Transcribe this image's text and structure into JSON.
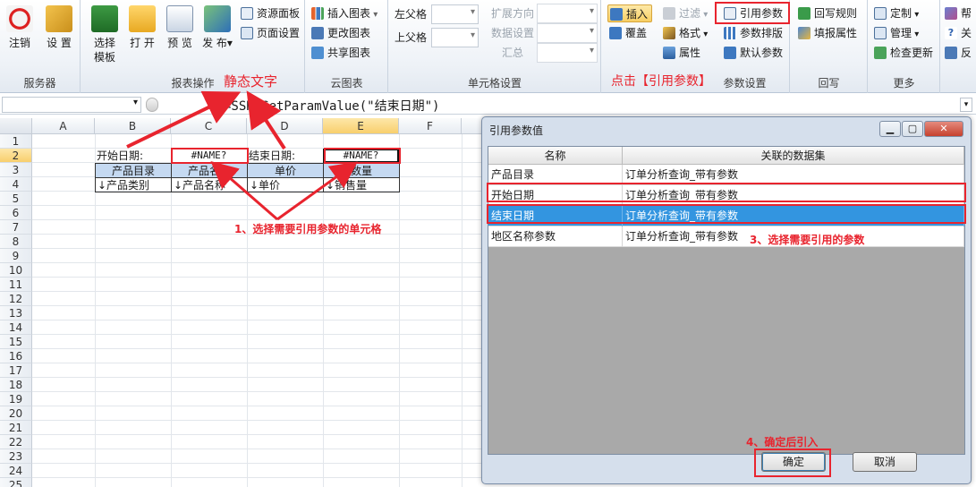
{
  "ribbon": {
    "groups": [
      {
        "label": "服务器",
        "buttons": [
          "注销",
          "设置"
        ]
      },
      {
        "label": "报表操作",
        "buttons": [
          "选择模板",
          "打开",
          "预览",
          "发布"
        ]
      },
      {
        "label": "云图表",
        "buttons": [
          "插入图表",
          "更改图表",
          "共享图表"
        ]
      },
      {
        "label": "单元格设置"
      },
      {
        "label": "参数设置"
      },
      {
        "label": "回写"
      },
      {
        "label": "更多"
      }
    ],
    "server_logout": "注销",
    "server_settings": "设 置",
    "select_template": "选择\n模板",
    "open": "打 开",
    "preview": "预 览",
    "publish": "发 布",
    "publish_arrow": "▾",
    "resource_panel": "资源面板",
    "page_settings": "页面设置",
    "insert_chart": "插入图表",
    "change_chart": "更改图表",
    "share_chart": "共享图表",
    "left_parent": "左父格",
    "top_parent": "上父格",
    "expand_dir": "扩展方向",
    "data_settings": "数据设置",
    "summary": "汇总",
    "insert": "插入",
    "cover": "覆盖",
    "filter": "过滤",
    "format": "格式",
    "property": "属性",
    "ref_param": "引用参数",
    "param_layout": "参数排版",
    "default_param": "默认参数",
    "writeback_rule": "回写规则",
    "fill_property": "填报属性",
    "customize": "定制",
    "manage": "管理",
    "check_update": "检查更新",
    "help": "帮",
    "about": "关",
    "feedback": "反"
  },
  "formula": {
    "value": "=SSR_GetParamValue(\"结束日期\")"
  },
  "sheet": {
    "columns": [
      "A",
      "B",
      "C",
      "D",
      "E",
      "F"
    ],
    "selected_column": "E",
    "rows": [
      "1",
      "2",
      "3",
      "4",
      "5",
      "6",
      "7",
      "8",
      "9",
      "10",
      "11",
      "12",
      "13",
      "14",
      "15",
      "16",
      "17",
      "18",
      "19",
      "20",
      "21",
      "22",
      "23",
      "24",
      "25"
    ],
    "selected_row": "2",
    "cells": {
      "b2": "开始日期:",
      "c2": "#NAME?",
      "d2": "结束日期:",
      "e2": "#NAME?",
      "b3": "产品目录",
      "c3": "产品名称",
      "d3": "单价",
      "e3": "数量",
      "b4": "↓产品类别",
      "c4": "↓产品名称",
      "d4": "↓单价",
      "e4": "↓销售量"
    }
  },
  "dialog": {
    "title": "引用参数值",
    "columns": [
      "名称",
      "关联的数据集"
    ],
    "rows": [
      {
        "name": "产品目录",
        "dataset": "订单分析查询_带有参数"
      },
      {
        "name": "开始日期",
        "dataset": "订单分析查询_带有参数"
      },
      {
        "name": "结束日期",
        "dataset": "订单分析查询_带有参数"
      },
      {
        "name": "地区名称参数",
        "dataset": "订单分析查询_带有参数"
      }
    ],
    "ok": "确定",
    "cancel": "取消"
  },
  "annotations": {
    "static_text": "静态文字",
    "click_ref": "点击【引用参数】",
    "step1": "1、选择需要引用参数的单元格",
    "step3": "3、选择需要引用的参数",
    "step4": "4、确定后引入"
  },
  "colors": {
    "annotation": "#e8242e",
    "selection": "#3395e0",
    "header_fill": "#c5d9f1"
  }
}
